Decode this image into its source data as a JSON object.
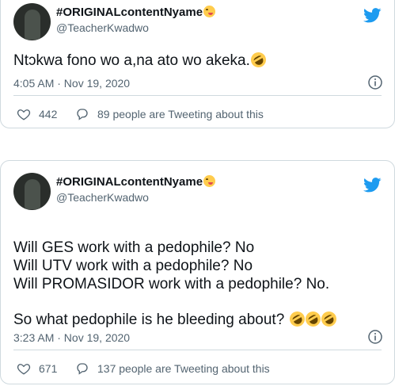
{
  "tweets": [
    {
      "display_name": "#ORIGINALcontentNyame",
      "name_emoji": "winking-face-tongue-emoji",
      "handle": "@TeacherKwadwo",
      "lines": [
        "Ntɔkwa fono wo a,na ato wo akeka."
      ],
      "trailing_emoji": "rolling-on-floor-laughing-emoji",
      "trailing_emoji_count": 1,
      "timestamp": "4:05 AM · Nov 19, 2020",
      "likes": "442",
      "activity": "89 people are Tweeting about this"
    },
    {
      "display_name": "#ORIGINALcontentNyame",
      "name_emoji": "winking-face-tongue-emoji",
      "handle": "@TeacherKwadwo",
      "lines": [
        "Will GES work with a pedophile? No",
        "Will UTV work with a pedophile? No",
        "Will PROMASIDOR work with a pedophile? No.",
        "",
        "So what pedophile is he bleeding about?"
      ],
      "trailing_emoji": "rolling-on-floor-laughing-emoji",
      "trailing_emoji_count": 3,
      "timestamp": "3:23 AM · Nov 19, 2020",
      "likes": "671",
      "activity": "137 people are Tweeting about this"
    }
  ],
  "colors": {
    "twitter_blue": "#1d9bf0",
    "text_primary": "#0f1419",
    "text_secondary": "#536471",
    "border": "#cfd9de"
  },
  "icons": {
    "logo": "twitter-bird-icon",
    "info": "info-icon",
    "like": "heart-icon",
    "reply": "reply-bubble-icon"
  }
}
